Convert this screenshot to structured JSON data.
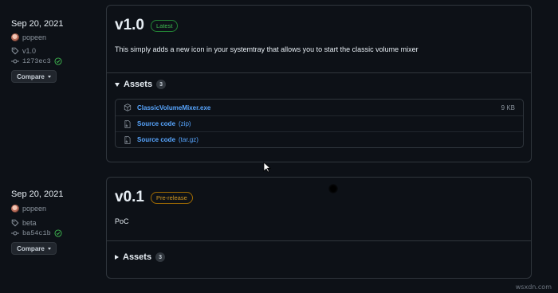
{
  "releases": [
    {
      "date": "Sep 20, 2021",
      "author": "popeen",
      "tag": "v1.0",
      "commit": "1273ec3",
      "verified": true,
      "compare_label": "Compare",
      "version": "v1.0",
      "badge": "Latest",
      "badge_kind": "latest",
      "description": "This simply adds a new icon in your systemtray that allows you to start the classic volume mixer",
      "assets_label": "Assets",
      "assets_count": "3",
      "assets_expanded": true,
      "assets": [
        {
          "name": "ClassicVolumeMixer.exe",
          "suffix": "",
          "size": "9 KB",
          "icon": "package-icon"
        },
        {
          "name": "Source code",
          "suffix": "(zip)",
          "size": "",
          "icon": "file-zip-icon"
        },
        {
          "name": "Source code",
          "suffix": "(tar.gz)",
          "size": "",
          "icon": "file-zip-icon"
        }
      ]
    },
    {
      "date": "Sep 20, 2021",
      "author": "popeen",
      "tag": "beta",
      "commit": "ba54c1b",
      "verified": true,
      "compare_label": "Compare",
      "version": "v0.1",
      "badge": "Pre-release",
      "badge_kind": "pre-release",
      "description": "PoC",
      "assets_label": "Assets",
      "assets_count": "3",
      "assets_expanded": false
    }
  ],
  "watermark": "wsxdn.com"
}
